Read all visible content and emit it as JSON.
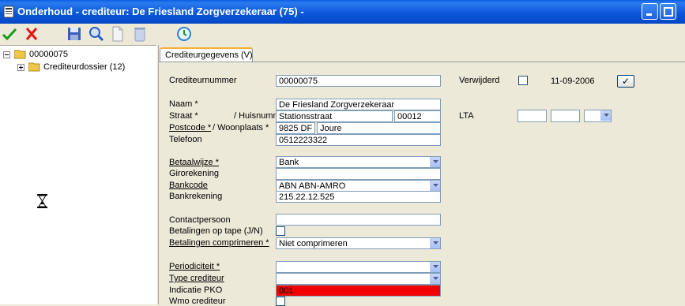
{
  "window": {
    "title": "Onderhoud - crediteur: De Friesland Zorgverzekeraar (75) -"
  },
  "toolbar": {
    "buttons": [
      {
        "name": "confirm",
        "icon": "check-icon"
      },
      {
        "name": "cancel",
        "icon": "cross-icon"
      },
      {
        "name": "save",
        "icon": "floppy-icon"
      },
      {
        "name": "search",
        "icon": "magnifier-icon"
      },
      {
        "name": "new",
        "icon": "document-icon"
      },
      {
        "name": "delete",
        "icon": "trash-icon"
      },
      {
        "name": "refresh",
        "icon": "refresh-icon"
      }
    ]
  },
  "tree": {
    "root": "00000075",
    "child": "Crediteurdossier (12)"
  },
  "tab": {
    "label": "Crediteurgegevens (V)"
  },
  "form": {
    "crediteurnummer": {
      "label": "Crediteurnummer",
      "value": "00000075"
    },
    "verwijderd": {
      "label": "Verwijderd",
      "date": "11-09-2006",
      "button": "✓"
    },
    "naam": {
      "label": "Naam *",
      "value": "De Friesland Zorgverzekeraar"
    },
    "straat": {
      "label": "Straat *",
      "label2": "/ Huisnummer",
      "value": "Stationsstraat",
      "huisnummer": "00012"
    },
    "postcode": {
      "label": "Postcode *",
      "label2": "/ Woonplaats *",
      "value": "9825 DF",
      "woonplaats": "Joure"
    },
    "telefoon": {
      "label": "Telefoon",
      "value": "0512223322"
    },
    "lta": {
      "label": "LTA"
    },
    "betaalwijze": {
      "label": "Betaalwijze *",
      "value": "Bank"
    },
    "girorekening": {
      "label": "Girorekening",
      "value": ""
    },
    "bankcode": {
      "label": "Bankcode",
      "value": "ABN ABN-AMRO"
    },
    "bankrekening": {
      "label": "Bankrekening",
      "value": "215.22.12.525"
    },
    "contactpersoon": {
      "label": "Contactpersoon",
      "value": ""
    },
    "betalingen_tape": {
      "label": "Betalingen op tape (J/N)"
    },
    "betalingen_comprimeren": {
      "label": "Betalingen comprimeren *",
      "value": "Niet comprimeren"
    },
    "periodiciteit": {
      "label": "Periodiciteit *",
      "value": ""
    },
    "type_crediteur": {
      "label": "Type crediteur",
      "value": ""
    },
    "indicatie_pko": {
      "label": "Indicatie PKO",
      "value": "001"
    },
    "wmo_crediteur": {
      "label": "Wmo crediteur"
    }
  },
  "colors": {
    "titlebar": "#0b58d8",
    "pko_highlight": "#f00000",
    "tab_accent": "#f9b033"
  }
}
